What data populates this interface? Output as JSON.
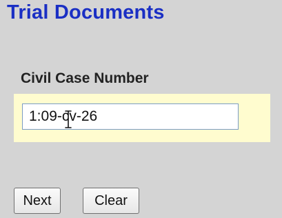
{
  "page": {
    "title": "Trial Documents"
  },
  "form": {
    "case_label": "Civil Case Number",
    "case_value": "1:09-cv-26"
  },
  "buttons": {
    "next_label": "Next",
    "clear_label": "Clear"
  },
  "colors": {
    "title": "#1a2fc4",
    "panel_background": "#fffccf",
    "page_background": "#d4d4d4"
  },
  "icons": {
    "cursor": "text-cursor-icon"
  }
}
